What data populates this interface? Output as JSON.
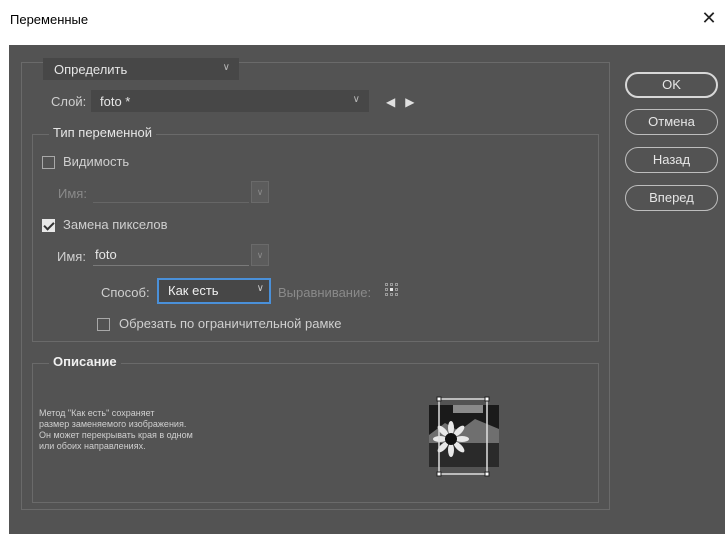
{
  "window": {
    "title": "Переменные",
    "close_glyph": "✕"
  },
  "top": {
    "mode_dropdown": "Определить",
    "layer_label": "Слой:",
    "layer_value": "foto *",
    "prev_arrow": "◀",
    "next_arrow": "▶"
  },
  "buttons": {
    "ok": "OK",
    "cancel": "Отмена",
    "back": "Назад",
    "forward": "Вперед"
  },
  "var_type": {
    "legend": "Тип переменной",
    "visibility": {
      "label": "Видимость",
      "checked": false,
      "name_label": "Имя:",
      "name_value": ""
    },
    "pixel_replace": {
      "label": "Замена пикселов",
      "checked": true,
      "name_label": "Имя:",
      "name_value": "foto",
      "method_label": "Способ:",
      "method_value": "Как есть",
      "align_label": "Выравнивание:"
    },
    "clip": {
      "label": "Обрезать по ограничительной рамке",
      "checked": false
    }
  },
  "description": {
    "legend": "Описание",
    "text": "Метод \"Как есть\" сохраняет\nразмер заменяемого изображения.\nОн может перекрывать края в одном\nили обоих направлениях."
  },
  "colors": {
    "panel": "#535353",
    "field": "#474747",
    "focus": "#4a90d9"
  },
  "icons": {
    "close": "close-icon",
    "chevron": "chevron-down-icon",
    "prev": "arrow-left-icon",
    "next": "arrow-right-icon",
    "align": "alignment-grid-icon",
    "preview": "sunflower-preview-image"
  }
}
